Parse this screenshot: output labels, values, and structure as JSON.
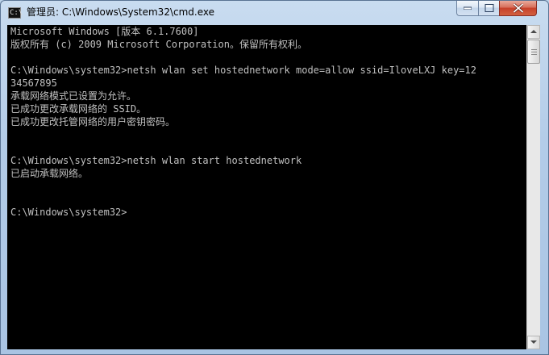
{
  "window": {
    "title": "管理员: C:\\Windows\\System32\\cmd.exe",
    "icon": "cmd-icon",
    "icon_glyph": "C:\\"
  },
  "controls": {
    "minimize_icon": "minimize-icon",
    "maximize_icon": "maximize-icon",
    "close_icon": "close-icon"
  },
  "console": {
    "lines": [
      "Microsoft Windows [版本 6.1.7600]",
      "版权所有 (c) 2009 Microsoft Corporation。保留所有权利。",
      "",
      "C:\\Windows\\system32>netsh wlan set hostednetwork mode=allow ssid=IloveLXJ key=12",
      "34567895",
      "承载网络模式已设置为允许。",
      "已成功更改承载网络的 SSID。",
      "已成功更改托管网络的用户密钥密码。",
      "",
      "",
      "C:\\Windows\\system32>netsh wlan start hostednetwork",
      "已启动承载网络。",
      "",
      "",
      "C:\\Windows\\system32>"
    ],
    "colors": {
      "background": "#000000",
      "text": "#c0c0c0"
    }
  },
  "scrollbar": {
    "up_icon": "scroll-up-arrow-icon",
    "down_icon": "scroll-down-arrow-icon"
  }
}
